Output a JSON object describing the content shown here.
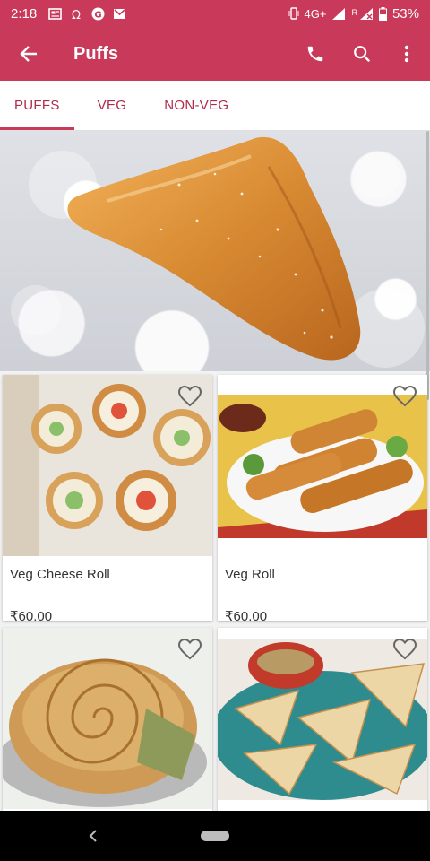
{
  "status_bar": {
    "time": "2:18",
    "network": "4G+",
    "signal2_label": "R",
    "battery": "53%"
  },
  "app_bar": {
    "title": "Puffs",
    "icons": [
      "back-arrow-icon",
      "phone-icon",
      "search-icon",
      "more-vert-icon"
    ]
  },
  "tabs": [
    {
      "label": "PUFFS",
      "active": true
    },
    {
      "label": "VEG",
      "active": false
    },
    {
      "label": "NON-VEG",
      "active": false
    }
  ],
  "products": [
    {
      "name": "Veg Cheese Roll",
      "price": "₹60.00"
    },
    {
      "name": "Veg Roll",
      "price": "₹60.00"
    },
    {
      "name": "",
      "price": ""
    },
    {
      "name": "",
      "price": ""
    }
  ],
  "colors": {
    "primary": "#c9395a",
    "tab_text": "#b02a4a",
    "card_text": "#333333"
  }
}
